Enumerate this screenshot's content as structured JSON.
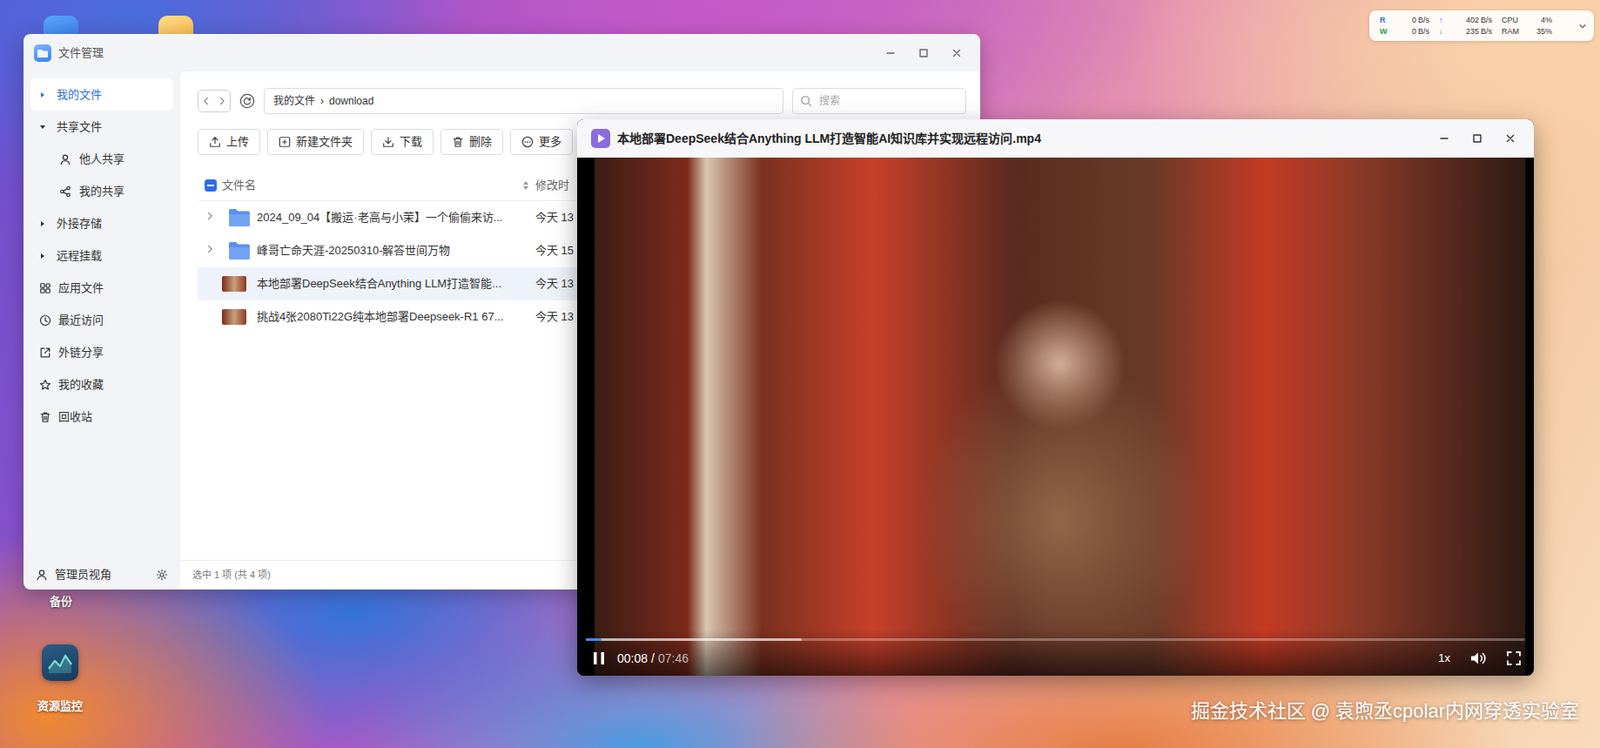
{
  "desktop": {
    "icons": [
      {
        "label": "备份"
      },
      {
        "label": "资源监控"
      }
    ]
  },
  "monitor": {
    "rows": [
      {
        "io": "R",
        "io_value": "0",
        "io_unit": "B/s",
        "arrow": "↑",
        "net_value": "402",
        "net_unit": "B/s",
        "metric": "CPU",
        "metric_value": "4%",
        "color": "#2f6fd8"
      },
      {
        "io": "W",
        "io_value": "0",
        "io_unit": "B/s",
        "arrow": "↓",
        "net_value": "235",
        "net_unit": "B/s",
        "metric": "RAM",
        "metric_value": "35%",
        "color": "#23a047"
      }
    ]
  },
  "file_manager": {
    "title": "文件管理",
    "sidebar": {
      "items": [
        {
          "label": "我的文件",
          "kind": "group",
          "expanded": false,
          "selected": true
        },
        {
          "label": "共享文件",
          "kind": "group",
          "expanded": true,
          "selected": false
        },
        {
          "label": "他人共享",
          "kind": "child",
          "selected": false
        },
        {
          "label": "我的共享",
          "kind": "child",
          "selected": false
        },
        {
          "label": "外接存储",
          "kind": "group",
          "expanded": false,
          "selected": false
        },
        {
          "label": "远程挂载",
          "kind": "group",
          "expanded": false,
          "selected": false
        },
        {
          "label": "应用文件",
          "kind": "link",
          "selected": false
        },
        {
          "label": "最近访问",
          "kind": "link",
          "selected": false
        },
        {
          "label": "外链分享",
          "kind": "link",
          "selected": false
        },
        {
          "label": "我的收藏",
          "kind": "link",
          "selected": false
        },
        {
          "label": "回收站",
          "kind": "link",
          "selected": false
        }
      ],
      "footer": "管理员视角"
    },
    "breadcrumb": {
      "items": [
        "我的文件",
        "download"
      ],
      "separator": "›"
    },
    "search": {
      "placeholder": "搜索"
    },
    "toolbar": [
      "上传",
      "新建文件夹",
      "下载",
      "删除",
      "更多"
    ],
    "table": {
      "select_all": {
        "checked": false,
        "partial": true
      },
      "columns": [
        "文件名",
        "修改时"
      ],
      "rows": [
        {
          "kind": "folder",
          "name": "2024_09_04【搬运·老高与小茉】一个偷偷来访...",
          "modified": "今天 13",
          "selected": false
        },
        {
          "kind": "folder",
          "name": "峰哥亡命天涯-20250310-解答世间万物",
          "modified": "今天 15",
          "selected": false
        },
        {
          "kind": "video",
          "name": "本地部署DeepSeek结合Anything LLM打造智能...",
          "modified": "今天 13",
          "selected": true
        },
        {
          "kind": "video",
          "name": "挑战4张2080Ti22G纯本地部署Deepseek-R1 67...",
          "modified": "今天 13",
          "selected": false
        }
      ]
    },
    "status_bar": "选中 1 项 (共 4 项)"
  },
  "player": {
    "title": "本地部署DeepSeek结合Anything LLM打造智能AI知识库并实现远程访问.mp4",
    "playing": true,
    "current": "00:08",
    "separator": "/",
    "duration": "07:46",
    "played": 0.017,
    "buffered": 0.23,
    "speed": "1x",
    "muted": false
  },
  "watermark": "掘金技术社区 @ 袁煦丞cpolar内网穿透实验室"
}
